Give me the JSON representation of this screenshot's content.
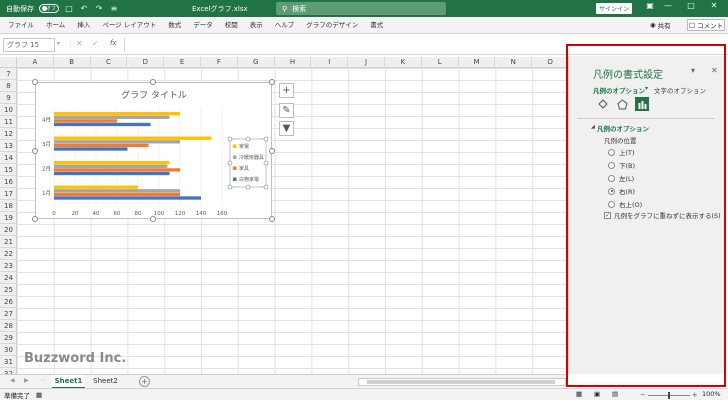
{
  "titlebar": {
    "autosave_label": "自動保存",
    "autosave_state": "オフ",
    "file_name": "Excelグラフ.xlsx",
    "search_placeholder": "検索",
    "signin_label": "サインイン"
  },
  "ribbon": {
    "tabs": [
      "ファイル",
      "ホーム",
      "挿入",
      "ページ レイアウト",
      "数式",
      "データ",
      "校閲",
      "表示",
      "ヘルプ",
      "グラフのデザイン",
      "書式"
    ],
    "share_label": "共有",
    "comment_label": "コメント"
  },
  "formula_bar": {
    "name_box": "グラフ 15",
    "fx_label": "fx"
  },
  "grid": {
    "columns": [
      "A",
      "B",
      "C",
      "D",
      "E",
      "F",
      "G",
      "H",
      "I",
      "J",
      "K",
      "L",
      "M",
      "N",
      "O"
    ],
    "rows": [
      "7",
      "8",
      "9",
      "10",
      "11",
      "12",
      "13",
      "14",
      "15",
      "16",
      "17",
      "18",
      "19",
      "20",
      "21",
      "22",
      "23",
      "24",
      "25",
      "26",
      "27",
      "28",
      "29",
      "30",
      "31",
      "32"
    ]
  },
  "chart_data": {
    "type": "bar",
    "orientation": "horizontal",
    "title": "グラフ タイトル",
    "categories": [
      "1月",
      "2月",
      "3月",
      "4月"
    ],
    "series": [
      {
        "name": "白物家電",
        "color": "#4472c4",
        "values": [
          140,
          110,
          70,
          92
        ]
      },
      {
        "name": "家具",
        "color": "#ed7d31",
        "values": [
          120,
          120,
          90,
          60
        ]
      },
      {
        "name": "冷暖房器具",
        "color": "#a5a5a5",
        "values": [
          120,
          108,
          120,
          110
        ]
      },
      {
        "name": "家電",
        "color": "#ffc000",
        "values": [
          80,
          110,
          150,
          120
        ]
      }
    ],
    "xlim": [
      0,
      160
    ],
    "xticks": [
      "0",
      "20",
      "40",
      "60",
      "80",
      "100",
      "120",
      "140",
      "160"
    ],
    "legend_position": "right"
  },
  "sheets": {
    "tabs": [
      "Sheet1",
      "Sheet2"
    ],
    "active": "Sheet1"
  },
  "status": {
    "ready": "準備完了",
    "zoom": "100%"
  },
  "pane": {
    "title": "凡例の書式設定",
    "tab_legend": "凡例のオプション",
    "tab_text": "文字のオプション",
    "section": "凡例のオプション",
    "position_label": "凡例の位置",
    "options": [
      "上(T)",
      "下(B)",
      "左(L)",
      "右(R)",
      "右上(O)"
    ],
    "selected": "右(R)",
    "overlap_label": "凡例をグラフに重ねずに表示する(S)"
  },
  "watermark": "Buzzword Inc."
}
